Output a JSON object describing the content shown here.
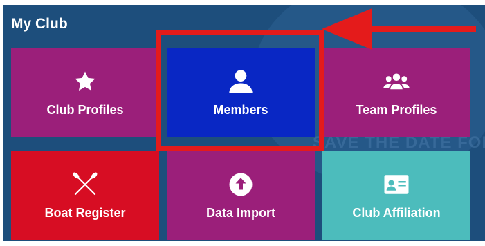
{
  "panel": {
    "title": "My Club"
  },
  "background": {
    "faded_text": "SAVE THE DATE FOR TE"
  },
  "tiles": [
    {
      "label": "Club Profiles",
      "icon": "star-icon",
      "color": "#9b1f7a"
    },
    {
      "label": "Members",
      "icon": "user-icon",
      "color": "#0927c4"
    },
    {
      "label": "Team Profiles",
      "icon": "users-icon",
      "color": "#9b1f7a"
    },
    {
      "label": "Boat Register",
      "icon": "crossed-oars-icon",
      "color": "#d70d23"
    },
    {
      "label": "Data Import",
      "icon": "upload-icon",
      "color": "#9b1f7a"
    },
    {
      "label": "Club Affiliation",
      "icon": "id-card-icon",
      "color": "#4cbcbc"
    }
  ],
  "annotation": {
    "color": "#e41b1b",
    "highlight": "Members"
  }
}
